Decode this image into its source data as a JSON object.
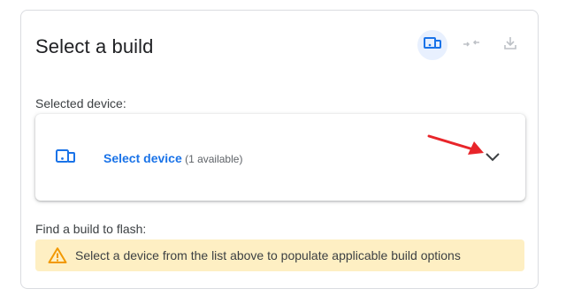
{
  "header": {
    "title": "Select a build",
    "icons": [
      "device-icon",
      "connect-icon",
      "download-icon"
    ]
  },
  "device_section": {
    "label": "Selected device:",
    "link_text": "Select device",
    "count_text": " (1 available)",
    "icon": "device-icon",
    "expand_icon": "chevron-down-icon"
  },
  "build_section": {
    "label": "Find a build to flash:",
    "warning": "Select a device from the list above to populate applicable build options",
    "warning_icon": "warning-icon"
  },
  "colors": {
    "accent": "#1a73e8",
    "warning_bg": "#feefc3",
    "warning_icon": "#f9ab00",
    "arrow": "#e8252a"
  }
}
